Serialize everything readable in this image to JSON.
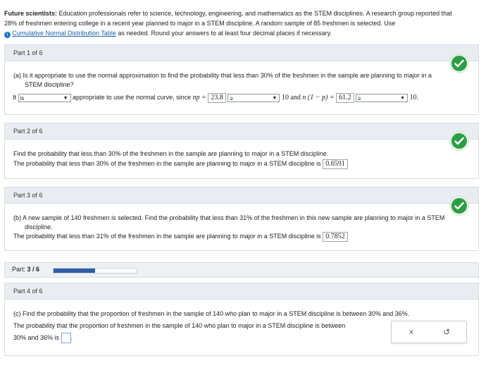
{
  "intro": {
    "title": "Future scientists:",
    "body": "Education professionals refer to science, technology, engineering, and mathematics as the STEM disciplines. A research group reported that",
    "line2": "28% of freshmen entering college in a recent year planned to major in a STEM discipline. A random sample of 85 freshmen is selected. Use",
    "link": "Cumulative Normal Distribution Table",
    "line3_tail": "as needed. Round your answers to at least four decimal places if necessary."
  },
  "part1": {
    "header": "Part 1 of 6",
    "question_l1": "(a) Is it appropriate to use the normal approximation to find the probability that less than 30% of the freshmen in the sample are planning to major in a",
    "question_l2": "STEM discipline?",
    "it": "It",
    "select1": "is",
    "mid": "appropriate to use the normal curve, since",
    "np_label": "np =",
    "np_value": "23.8",
    "select2": "≥",
    "ten_and": "10 and",
    "nq_label": "n (1 − p) =",
    "nq_value": "61.2",
    "select3": "≥",
    "ten_end": "10."
  },
  "part2": {
    "header": "Part 2 of 6",
    "line1": "Find the probability that less than 30% of the freshmen in the sample are planning to major in a STEM discipline.",
    "line2": "The probability that less than 30% of the freshmen in the sample are planning to major in a STEM discipline is",
    "answer": "0.6591"
  },
  "part3": {
    "header": "Part 3 of 6",
    "line1": "(b) A new sample of 140 freshmen is selected. Find the probability that less than 31% of the freshmen in this new sample are planning to major in a STEM",
    "line1b": "discipline.",
    "line2": "The probability that less than 31% of the freshmen in the sample are planning to major in a STEM discipline is",
    "answer": "0.7852"
  },
  "progress": {
    "label": "Part:",
    "value": "3 / 6",
    "fraction": 0.5
  },
  "part4": {
    "header": "Part 4 of 6",
    "line1": "(c) Find the probability that the proportion of freshmen in the sample of 140 who plan to major in a STEM discipline is between 30% and 36%.",
    "line2": "The probability that the proportion of freshmen in the sample of 140 who plan to major in a STEM discipline is between",
    "line3": "30% and 36% is"
  },
  "tools": {
    "clear": "×",
    "undo": "↺"
  },
  "colors": {
    "accent": "#2c5fa6",
    "check": "#2e9e44",
    "header_bg": "#e9edf1"
  }
}
